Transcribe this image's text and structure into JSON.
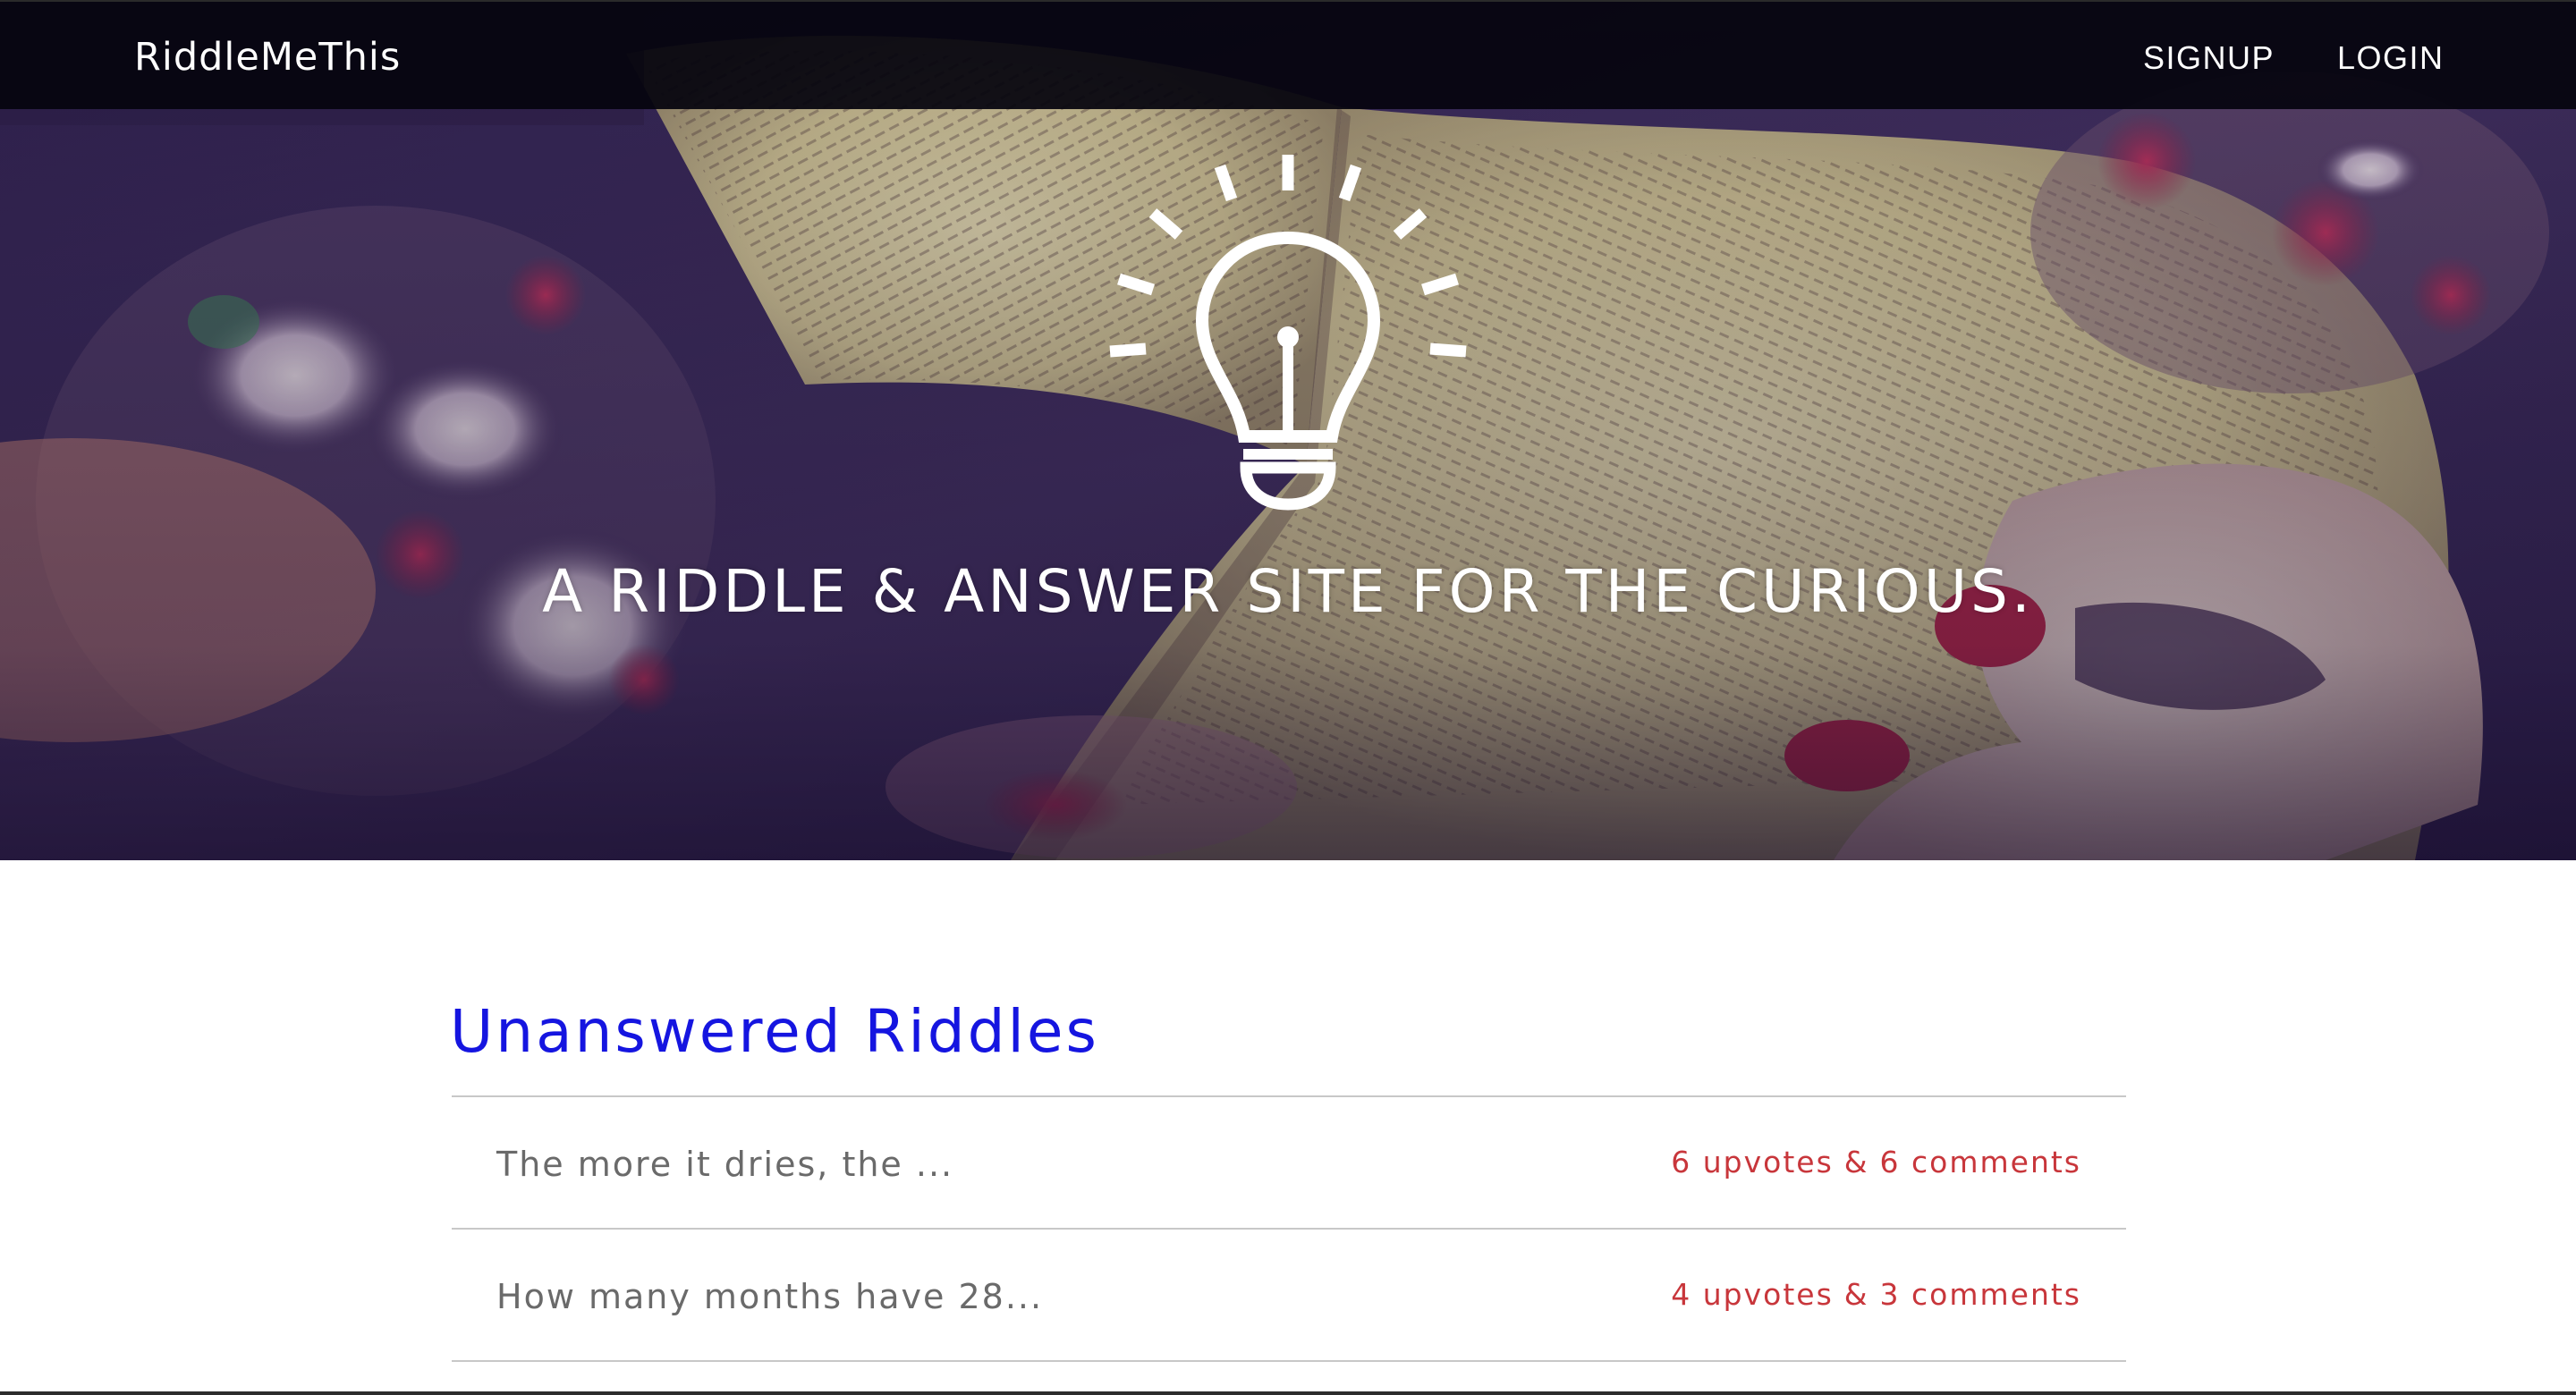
{
  "brand": {
    "name": "RiddleMeThis"
  },
  "nav": {
    "signup_label": "SIGNUP",
    "login_label": "LOGIN"
  },
  "hero": {
    "icon": "lightbulb-icon",
    "tagline": "A riddle & answer site for the curious."
  },
  "unanswered": {
    "title": "Unanswered Riddles",
    "riddles": [
      {
        "text": "The more it dries, the ...",
        "upvotes": "6 upvotes",
        "joiner": "&",
        "comments": "6 comments"
      },
      {
        "text": "How many months have 28...",
        "upvotes": "4 upvotes",
        "joiner": "&",
        "comments": "3 comments"
      }
    ]
  },
  "colors": {
    "navbar": "#05040e",
    "title_blue": "#1515e0",
    "stats_red": "#c8363b",
    "riddle_text_gray": "#6a6a6a",
    "divider": "#c8c8c8"
  }
}
